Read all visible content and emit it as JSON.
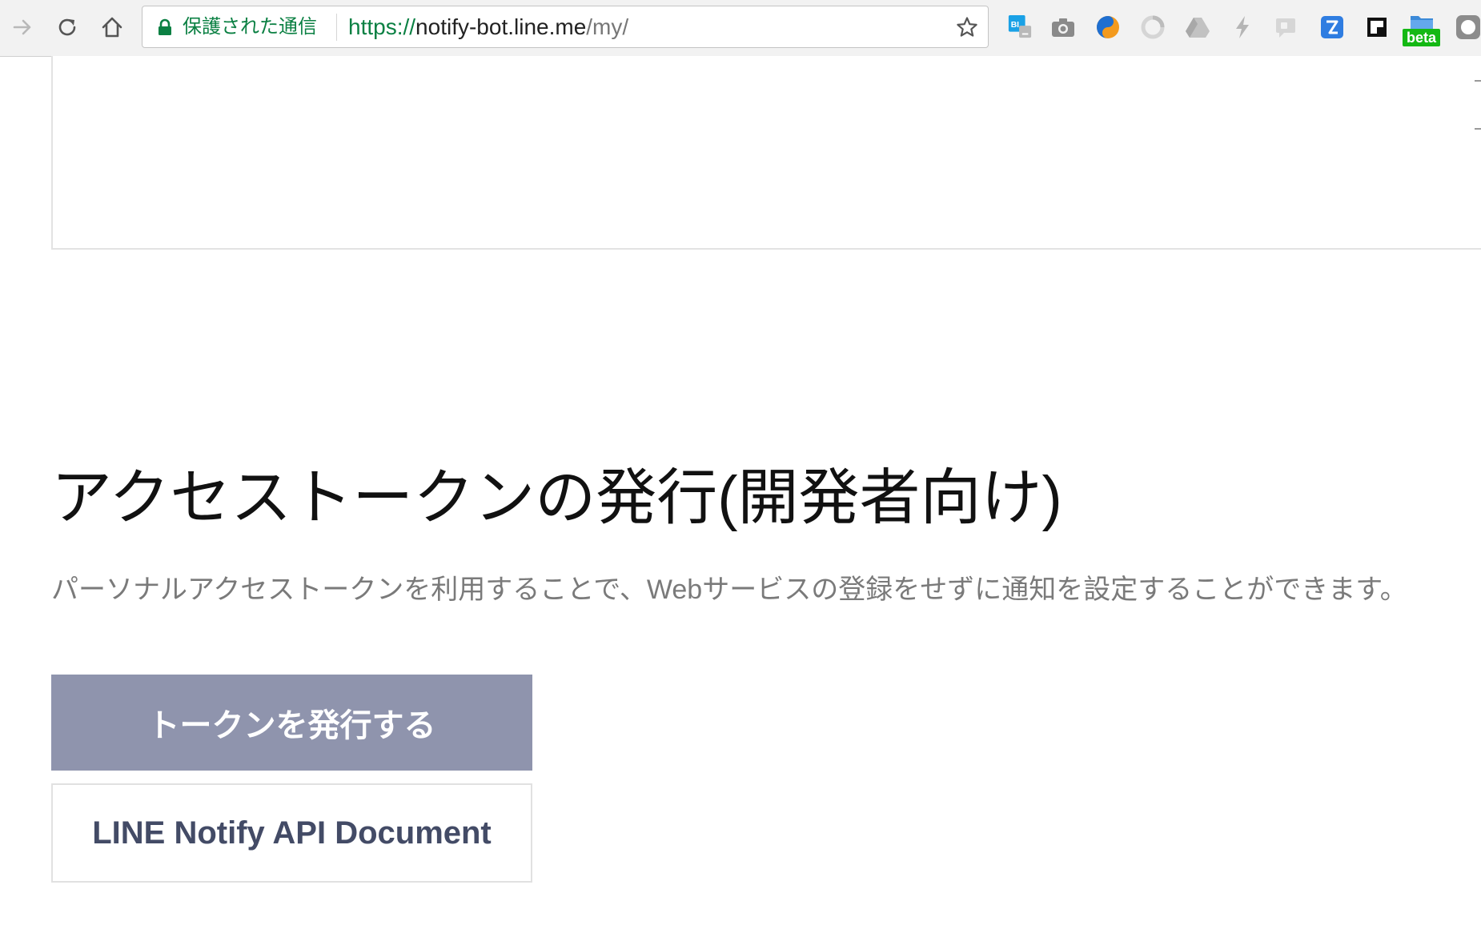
{
  "browser": {
    "security_label": "保護された通信",
    "url": {
      "scheme": "https://",
      "host": "notify-bot.line.me",
      "path": "/my/"
    },
    "extensions": [
      "bl-ext-icon",
      "camera-icon",
      "sphere-icon",
      "sync-icon",
      "drive-icon",
      "lightning-icon",
      "chat-icon",
      "check-icon",
      "window-icon",
      "folder-beta-icon",
      "profile-icon"
    ],
    "beta_badge": "beta"
  },
  "main": {
    "heading": "アクセストークンの発行(開発者向け)",
    "description": "パーソナルアクセストークンを利用することで、Webサービスの登録をせずに通知を設定することができます。",
    "issue_token_button": "トークンを発行する",
    "api_document_button": "LINE Notify API Document"
  },
  "colors": {
    "secure_green": "#0b8043",
    "issue_button_bg": "#8f94ad",
    "doc_button_text": "#434b66",
    "description_text": "#7a7a7a"
  }
}
